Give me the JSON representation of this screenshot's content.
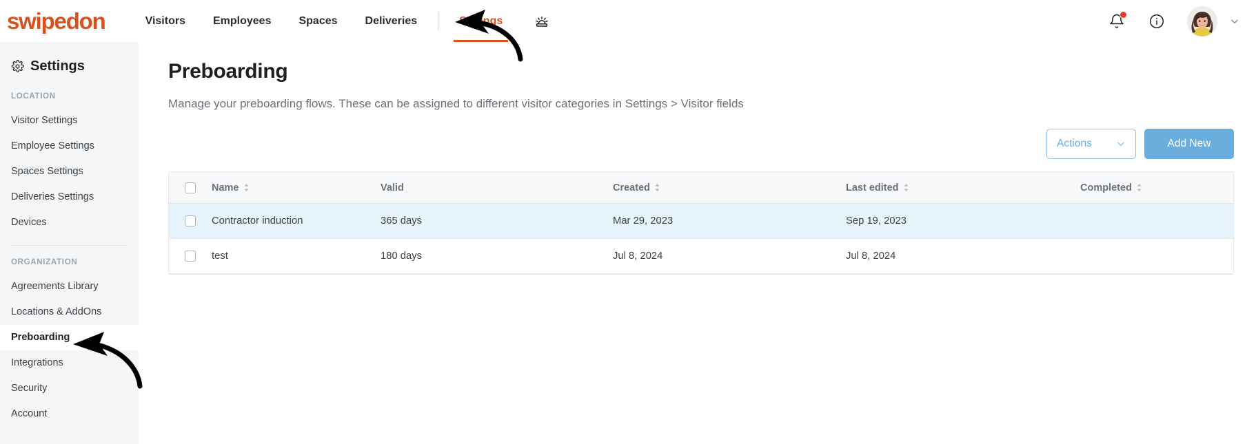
{
  "brand": {
    "logo_text": "swipedon",
    "accent_orange": "#D9511C",
    "accent_blue": "#6aaede",
    "row_highlight": "#E8F4FB"
  },
  "topnav": {
    "links": [
      {
        "label": "Visitors",
        "active": false
      },
      {
        "label": "Employees",
        "active": false
      },
      {
        "label": "Spaces",
        "active": false
      },
      {
        "label": "Deliveries",
        "active": false
      },
      {
        "label": "Settings",
        "active": true
      }
    ],
    "siren_icon": "siren-icon",
    "notifications_icon": "bell-icon",
    "info_icon": "info-circle-icon",
    "avatar_alt": "user-avatar",
    "account_chevron_icon": "chevron-down-icon"
  },
  "sidebar": {
    "title": "Settings",
    "title_icon": "gear-icon",
    "groups": [
      {
        "label": "LOCATION",
        "items": [
          {
            "label": "Visitor Settings",
            "active": false
          },
          {
            "label": "Employee Settings",
            "active": false
          },
          {
            "label": "Spaces Settings",
            "active": false
          },
          {
            "label": "Deliveries Settings",
            "active": false
          },
          {
            "label": "Devices",
            "active": false
          }
        ]
      },
      {
        "label": "ORGANIZATION",
        "items": [
          {
            "label": "Agreements Library",
            "active": false
          },
          {
            "label": "Locations & AddOns",
            "active": false
          },
          {
            "label": "Preboarding",
            "active": true
          },
          {
            "label": "Integrations",
            "active": false
          },
          {
            "label": "Security",
            "active": false
          },
          {
            "label": "Account",
            "active": false
          }
        ]
      }
    ]
  },
  "main": {
    "title": "Preboarding",
    "description": "Manage your preboarding flows. These can be assigned to different visitor categories in Settings > Visitor fields",
    "actions_button": "Actions",
    "actions_chevron_icon": "chevron-down-icon",
    "add_new_button": "Add New"
  },
  "table": {
    "columns": [
      {
        "label": "Name",
        "sortable": true
      },
      {
        "label": "Valid",
        "sortable": false
      },
      {
        "label": "Created",
        "sortable": true
      },
      {
        "label": "Last edited",
        "sortable": true
      },
      {
        "label": "Completed",
        "sortable": true
      }
    ],
    "rows": [
      {
        "name": "Contractor induction",
        "valid": "365 days",
        "created": "Mar 29, 2023",
        "last_edited": "Sep 19, 2023",
        "completed": "",
        "highlighted": true
      },
      {
        "name": "test",
        "valid": "180 days",
        "created": "Jul 8, 2024",
        "last_edited": "Jul 8, 2024",
        "completed": "",
        "highlighted": false
      }
    ]
  }
}
